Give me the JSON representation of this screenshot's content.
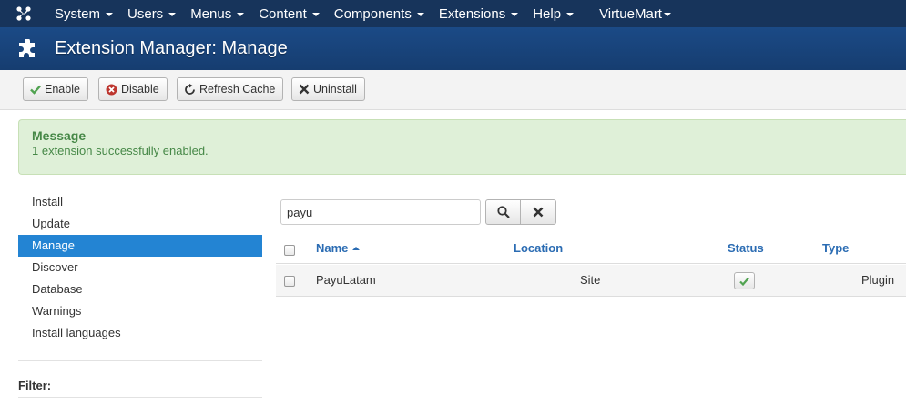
{
  "topnav": {
    "items": [
      {
        "label": "System"
      },
      {
        "label": "Users"
      },
      {
        "label": "Menus"
      },
      {
        "label": "Content"
      },
      {
        "label": "Components"
      },
      {
        "label": "Extensions"
      },
      {
        "label": "Help"
      }
    ],
    "extra": {
      "label": "VirtueMart"
    }
  },
  "header": {
    "title": "Extension Manager: Manage"
  },
  "toolbar": {
    "enable_label": "Enable",
    "disable_label": "Disable",
    "refresh_label": "Refresh Cache",
    "uninstall_label": "Uninstall"
  },
  "message": {
    "heading": "Message",
    "text": "1 extension successfully enabled."
  },
  "sidebar": {
    "items": [
      {
        "label": "Install"
      },
      {
        "label": "Update"
      },
      {
        "label": "Manage",
        "active": true
      },
      {
        "label": "Discover"
      },
      {
        "label": "Database"
      },
      {
        "label": "Warnings"
      },
      {
        "label": "Install languages"
      }
    ],
    "filter_label": "Filter:"
  },
  "search": {
    "value": "payu"
  },
  "table": {
    "columns": [
      "Name",
      "Location",
      "Status",
      "Type"
    ],
    "rows": [
      {
        "name": "PayuLatam",
        "location": "Site",
        "status": "enabled",
        "type": "Plugin"
      }
    ]
  },
  "colors": {
    "navbar": "#17345b",
    "titlebar": "#1b4a86",
    "accent": "#2384d3",
    "success_bg": "#dff0d8",
    "success_text": "#468847",
    "link": "#2b6cb3"
  }
}
